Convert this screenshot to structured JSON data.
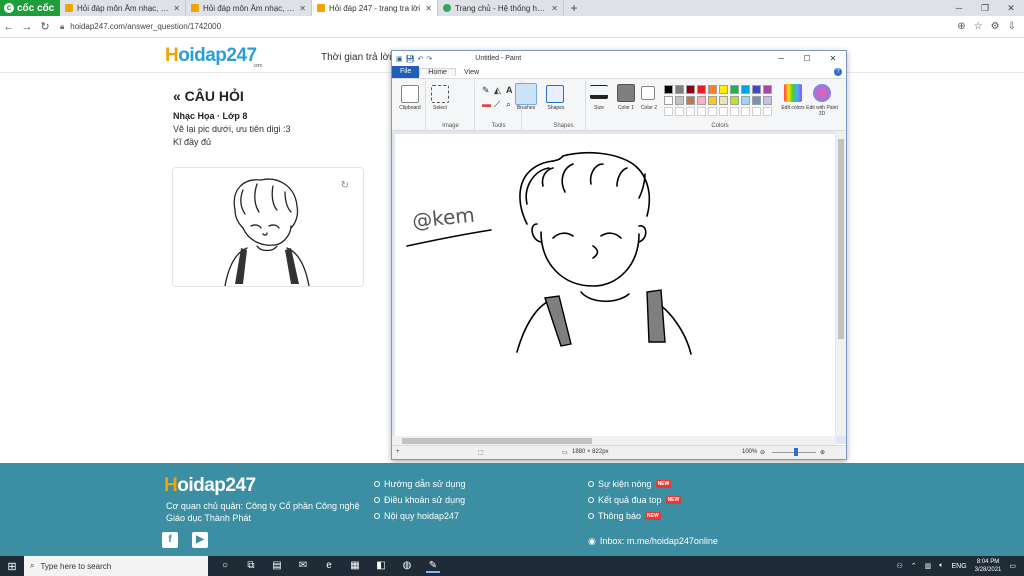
{
  "browser": {
    "brand": "cốc cốc",
    "tabs": [
      {
        "title": "Hỏi đáp môn Âm nhạc, Mỹ thu"
      },
      {
        "title": "Hỏi đáp môn Âm nhạc, Mỹ thu"
      },
      {
        "title": "Hỏi đáp 247 - trang tra lời"
      },
      {
        "title": "Trang chủ - Hệ thống học và"
      }
    ],
    "url": "hoidap247.com/answer_question/1742000",
    "new_tab": "+"
  },
  "header": {
    "logo_h": "H",
    "logo_rest": "oidap247",
    "logo_sub": ".com",
    "text": "Thời gian trả lời c"
  },
  "question": {
    "title": "« CÂU HỎI",
    "subject": "Nhạc Họa · Lớp 8",
    "line1": "Vẽ lại pic dưới, ưu tiên digi :3",
    "line2": "Kĩ đầy đủ"
  },
  "paint": {
    "title": "Untitled - Paint",
    "tabs": {
      "file": "File",
      "home": "Home",
      "view": "View"
    },
    "groups": {
      "clipboard": "Clipboard",
      "image": "Image",
      "tools": "Tools",
      "shapes": "Shapes",
      "colors": "Colors"
    },
    "tools": {
      "select": "Select",
      "brushes": "Brushes",
      "shapes": "Shapes",
      "size": "Size",
      "color1": "Color 1",
      "color2": "Color 2",
      "edit_colors": "Edit colors",
      "edit_paint3d": "Edit with Paint 3D"
    },
    "status_size": "1880 × 822px",
    "zoom": "100%",
    "signature": "@kem",
    "palette": [
      "#000000",
      "#7f7f7f",
      "#880015",
      "#ed1c24",
      "#ff7f27",
      "#fff200",
      "#22b14c",
      "#00a2e8",
      "#3f48cc",
      "#a349a4",
      "#ffffff",
      "#c3c3c3",
      "#b97a57",
      "#ffaec9",
      "#ffc90e",
      "#efe4b0",
      "#b5e61d",
      "#99d9ea",
      "#7092be",
      "#c8bfe7"
    ],
    "color1": "#7f7f7f"
  },
  "footer": {
    "logo_h": "H",
    "logo_rest": "oidap247",
    "logo_sub": ".com",
    "owner_line1": "Cơ quan chủ quản: Công ty Cổ phần Công nghệ",
    "owner_line2": "Giáo dục Thành Phát",
    "col1": [
      "Hướng dẫn sử dụng",
      "Điều khoản sử dụng",
      "Nội quy hoidap247"
    ],
    "col2": [
      "Sự kiện nóng",
      "Kết quả đua top",
      "Thông báo"
    ],
    "badge": "NEW",
    "inbox": "Inbox: m.me/hoidap247online"
  },
  "taskbar": {
    "search_placeholder": "Type here to search",
    "lang": "ENG",
    "time": "8:04 PM",
    "date": "3/28/2021"
  }
}
